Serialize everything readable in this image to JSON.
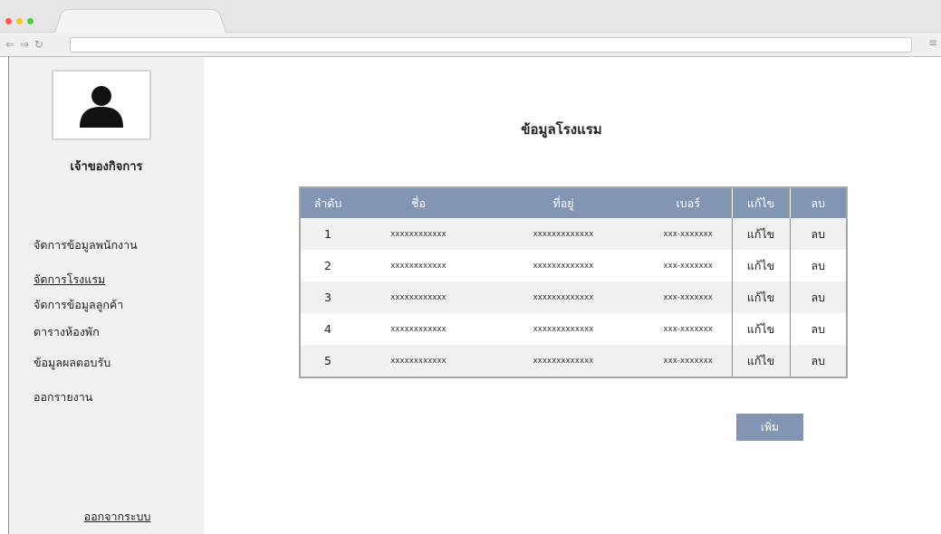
{
  "browser": {
    "url": "",
    "icons": {
      "back": "back-arrow-icon",
      "forward": "forward-arrow-icon",
      "reload": "reload-icon",
      "menu": "hamburger-menu-icon"
    }
  },
  "sidebar": {
    "owner_label": "เจ้าของกิจการ",
    "items": [
      {
        "label": "จัดการข้อมูลพนักงาน"
      },
      {
        "label": "จัดการโรงแรม"
      },
      {
        "label": "จัดการข้อมูลลูกค้า"
      },
      {
        "label": "ตารางห้องพัก"
      },
      {
        "label": "ข้อมูลผลตอบรับ"
      },
      {
        "label": "ออกรายงาน"
      }
    ],
    "active_index": 1,
    "logout_label": "ออกจากระบบ"
  },
  "main": {
    "title": "ข้อมูลโรงแรม",
    "table": {
      "headers": [
        "ลำดับ",
        "ชื่อ",
        "ที่อยู่",
        "เบอร์",
        "แก้ไข",
        "ลบ"
      ],
      "rows": [
        {
          "no": "1",
          "name": "xxxxxxxxxxxx",
          "address": "xxxxxxxxxxxxx",
          "phone": "xxx-xxxxxxx",
          "edit": "แก้ไข",
          "delete": "ลบ"
        },
        {
          "no": "2",
          "name": "xxxxxxxxxxxx",
          "address": "xxxxxxxxxxxxx",
          "phone": "xxx-xxxxxxx",
          "edit": "แก้ไข",
          "delete": "ลบ"
        },
        {
          "no": "3",
          "name": "xxxxxxxxxxxx",
          "address": "xxxxxxxxxxxxx",
          "phone": "xxx-xxxxxxx",
          "edit": "แก้ไข",
          "delete": "ลบ"
        },
        {
          "no": "4",
          "name": "xxxxxxxxxxxx",
          "address": "xxxxxxxxxxxxx",
          "phone": "xxx-xxxxxxx",
          "edit": "แก้ไข",
          "delete": "ลบ"
        },
        {
          "no": "5",
          "name": "xxxxxxxxxxxx",
          "address": "xxxxxxxxxxxxx",
          "phone": "xxx-xxxxxxx",
          "edit": "แก้ไข",
          "delete": "ลบ"
        }
      ]
    },
    "add_label": "เพิ่ม"
  },
  "colors": {
    "accent": "#8295b3",
    "sidebar_bg": "#f1f1f1",
    "row_alt": "#f1f1f1"
  }
}
